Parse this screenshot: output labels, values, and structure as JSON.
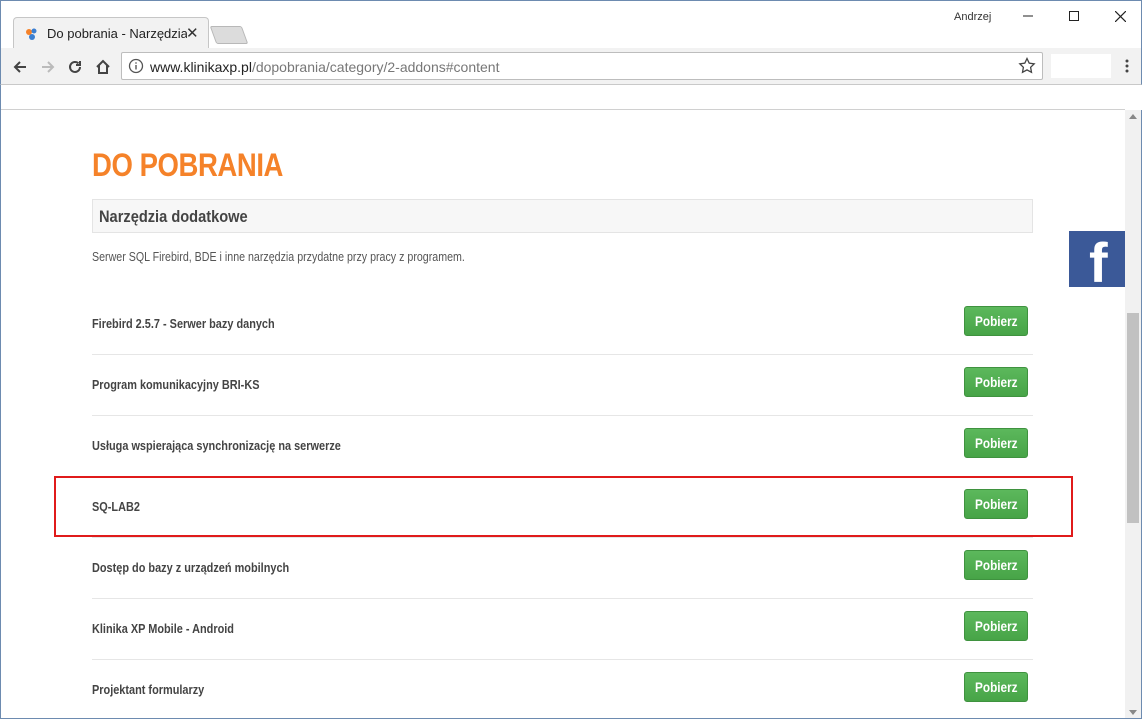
{
  "browser": {
    "tab_title": "Do pobrania - Narzędzia dodatkowe",
    "profile_name": "Andrzej",
    "url_host": "www.klinikaxp.pl",
    "url_path": "/dopobrania/category/2-addons#content"
  },
  "page": {
    "title": "DO POBRANIA",
    "section_title": "Narzędzia dodatkowe",
    "section_description": "Serwer SQL Firebird, BDE i inne narzędzia przydatne przy pracy z programem.",
    "downloads": [
      {
        "name": "Firebird 2.5.7 - Serwer bazy danych",
        "button": "Pobierz"
      },
      {
        "name": "Program komunikacyjny BRI-KS",
        "button": "Pobierz"
      },
      {
        "name": "Usługa wspierająca synchronizację na serwerze",
        "button": "Pobierz"
      },
      {
        "name": "SQ-LAB2",
        "button": "Pobierz"
      },
      {
        "name": "Dostęp do bazy z urządzeń mobilnych",
        "button": "Pobierz"
      },
      {
        "name": "Klinika XP Mobile - Android",
        "button": "Pobierz"
      },
      {
        "name": "Projektant formularzy",
        "button": "Pobierz"
      }
    ],
    "highlighted_item": "SQ-LAB2",
    "social": {
      "facebook_letter": "f"
    }
  },
  "colors": {
    "accent_orange": "#f58229",
    "button_green": "#5cb85c",
    "highlight_red": "#e01b1b",
    "facebook_blue": "#3b5998"
  },
  "icons": [
    "favicon",
    "close-icon",
    "minimize-icon",
    "maximize-icon",
    "window-close-icon",
    "back-icon",
    "forward-icon",
    "reload-icon",
    "home-icon",
    "info-icon",
    "star-icon",
    "menu-icon",
    "facebook-icon"
  ]
}
